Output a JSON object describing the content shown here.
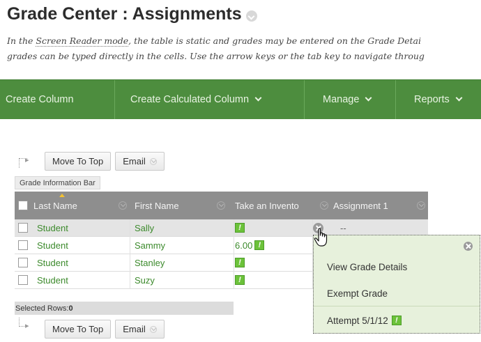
{
  "page": {
    "title": "Grade Center : Assignments",
    "help_line1_prefix": "In the ",
    "help_line1_link": "Screen Reader mode",
    "help_line1_suffix": ", the table is static and grades may be entered on the Grade Detai",
    "help_line2": "grades can be typed directly in the cells. Use the arrow keys or the tab key to navigate throug"
  },
  "toolbar": {
    "items": [
      {
        "label": "Create Column",
        "has_menu": false
      },
      {
        "label": "Create Calculated Column",
        "has_menu": true
      },
      {
        "label": "Manage",
        "has_menu": true
      },
      {
        "label": "Reports",
        "has_menu": true
      }
    ]
  },
  "actions": {
    "move_to_top": "Move To Top",
    "email": "Email"
  },
  "grid": {
    "info_bar_label": "Grade Information Bar",
    "columns": [
      "Last Name",
      "First Name",
      "Take an Invento",
      "Assignment 1"
    ],
    "rows": [
      {
        "last": "Student",
        "first": "Sally",
        "take_value": "",
        "take_flag": true,
        "assignment": "--"
      },
      {
        "last": "Student",
        "first": "Sammy",
        "take_value": "6.00",
        "take_flag": true,
        "assignment": ""
      },
      {
        "last": "Student",
        "first": "Stanley",
        "take_value": "",
        "take_flag": true,
        "assignment": ""
      },
      {
        "last": "Student",
        "first": "Suzy",
        "take_value": "",
        "take_flag": true,
        "assignment": ""
      }
    ],
    "selected_rows_label": "Selected Rows: ",
    "selected_rows_count": "0"
  },
  "context_menu": {
    "items": [
      "View Grade Details",
      "Exempt Grade",
      "Attempt 5/1/12"
    ]
  },
  "colors": {
    "toolbar_bg": "#4d8d3e",
    "link_green": "#3c8a2c",
    "flag_green": "#6cc23a",
    "popup_bg": "#e7f1dc",
    "header_bg": "#8e8e8e"
  }
}
